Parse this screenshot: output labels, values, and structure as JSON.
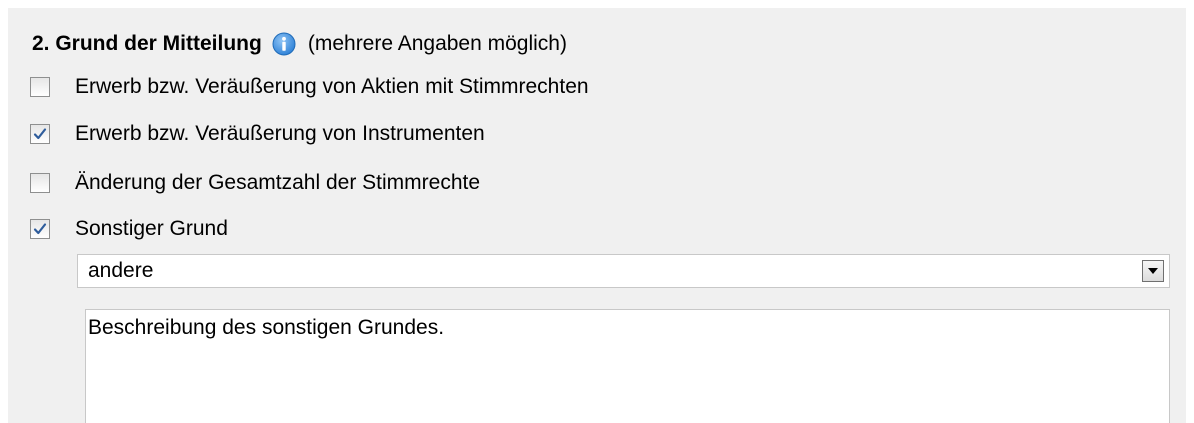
{
  "section": {
    "title": "2. Grund der Mitteilung",
    "hint": "(mehrere Angaben möglich)",
    "info_icon": "info-icon",
    "info_color": "#3c8fdc"
  },
  "options": [
    {
      "label": "Erwerb bzw. Veräußerung von Aktien mit Stimmrechten",
      "checked": false
    },
    {
      "label": "Erwerb bzw. Veräußerung von Instrumenten",
      "checked": true
    },
    {
      "label": "Änderung der Gesamtzahl der Stimmrechte",
      "checked": false
    },
    {
      "label": "Sonstiger Grund",
      "checked": true
    }
  ],
  "other_reason": {
    "select_value": "andere",
    "description": "Beschreibung des sonstigen Grundes."
  }
}
